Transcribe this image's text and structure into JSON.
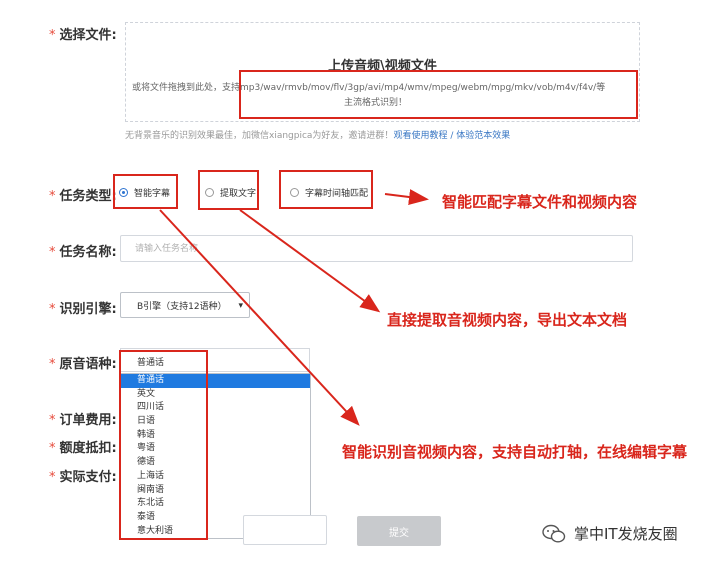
{
  "form": {
    "file": {
      "label": "选择文件:"
    },
    "task_type": {
      "label": "任务类型:"
    },
    "task_name": {
      "label": "任务名称:",
      "placeholder": "请输入任务名称"
    },
    "engine": {
      "label": "识别引擎:",
      "value": "B引擎（支持12语种）"
    },
    "language": {
      "label": "原音语种:",
      "value": "普通话"
    },
    "order_fee": {
      "label": "订单费用:"
    },
    "quota": {
      "label": "额度抵扣:"
    },
    "actual_pay": {
      "label": "实际支付:"
    }
  },
  "upload": {
    "title": "上传音频\\视频文件",
    "desc_line1": "或将文件拖拽到此处，支持mp3/wav/rmvb/mov/flv/3gp/avi/mp4/wmv/mpeg/webm/mpg/mkv/vob/m4v/f4v/等",
    "desc_line2": "主流格式识别！"
  },
  "hint": {
    "text": "无背景音乐的识别效果最佳，加微信xiangpica为好友，邀请进群！",
    "link1": "观看使用教程",
    "sep": " / ",
    "link2": "体验范本效果"
  },
  "task_types": [
    {
      "label": "智能字幕",
      "selected": true
    },
    {
      "label": "提取文字",
      "selected": false
    },
    {
      "label": "字幕时间轴匹配",
      "selected": false
    }
  ],
  "languages": [
    "普通话",
    "英文",
    "四川话",
    "日语",
    "韩语",
    "粤语",
    "德语",
    "上海话",
    "闽南语",
    "东北话",
    "泰语",
    "意大利语"
  ],
  "selected_language": "普通话",
  "submit_label": "提交",
  "annotations": {
    "a1": "智能匹配字幕文件和视频内容",
    "a2": "直接提取音视频内容，导出文本文档",
    "a3": "智能识别音视频内容，支持自动打轴，在线编辑字幕"
  },
  "watermark": "掌中IT发烧友圈",
  "colors": {
    "annotation_red": "#d9261c",
    "selected_blue": "#1f7ae0",
    "radio_blue": "#2f74d0",
    "submit_gray": "#c8cacd"
  }
}
